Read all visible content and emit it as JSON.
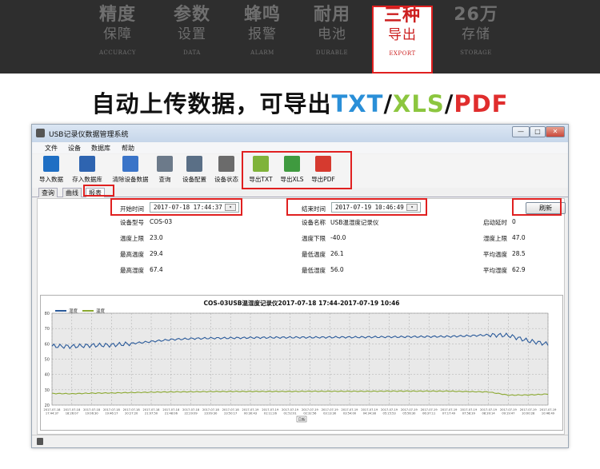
{
  "features": [
    {
      "big": "精度",
      "mid": "保障",
      "sml": "ACCURACY"
    },
    {
      "big": "参数",
      "mid": "设置",
      "sml": "DATA"
    },
    {
      "big": "蜂鸣",
      "mid": "报警",
      "sml": "ALARM"
    },
    {
      "big": "耐用",
      "mid": "电池",
      "sml": "DURABLE"
    },
    {
      "big": "三种",
      "mid": "导出",
      "sml": "EXPORT"
    },
    {
      "big": "26万",
      "mid": "存储",
      "sml": "STORAGE"
    }
  ],
  "headline": {
    "prefix": "自动上传数据，可导出",
    "txt": "TXT",
    "sep1": "/",
    "xls": "XLS",
    "sep2": "/",
    "pdf": "PDF",
    "colors": {
      "txt": "#2a8fd8",
      "xls": "#8cc63f",
      "pdf": "#e02d2d"
    }
  },
  "window": {
    "title": "USB记录仪数据管理系统",
    "controls": {
      "min": "—",
      "max": "□",
      "close": "✕"
    }
  },
  "menu": [
    "文件",
    "设备",
    "数据库",
    "帮助"
  ],
  "toolbar": [
    {
      "label": "导入数据",
      "icon": "import-data-icon"
    },
    {
      "label": "存入数据库",
      "icon": "save-database-icon"
    },
    {
      "label": "清除设备数据",
      "icon": "clear-device-icon"
    },
    {
      "label": "查询",
      "icon": "search-icon"
    },
    {
      "label": "设备配置",
      "icon": "device-config-icon"
    },
    {
      "label": "设备状态",
      "icon": "device-status-icon"
    },
    {
      "label": "导出TXT",
      "icon": "export-txt-icon"
    },
    {
      "label": "导出XLS",
      "icon": "export-xls-icon"
    },
    {
      "label": "导出PDF",
      "icon": "export-pdf-icon"
    }
  ],
  "tabs": [
    "查询",
    "曲线",
    "报表"
  ],
  "report": {
    "start_label": "开始时间",
    "start_value": "2017-07-18 17:44:37",
    "end_label": "结束时间",
    "end_value": "2017-07-19 10:46:49",
    "refresh": "刷新",
    "fields": [
      {
        "label": "设备型号",
        "value": "COS-03"
      },
      {
        "label": "设备名称",
        "value": "USB温湿度记录仪"
      },
      {
        "label": "启动延时",
        "value": "0"
      },
      {
        "label": "温度上限",
        "value": "23.0"
      },
      {
        "label": "温度下限",
        "value": "-40.0"
      },
      {
        "label": "湿度上限",
        "value": "47.0"
      },
      {
        "label": "最高温度",
        "value": "29.4"
      },
      {
        "label": "最低温度",
        "value": "26.1"
      },
      {
        "label": "平均温度",
        "value": "28.5"
      },
      {
        "label": "最高湿度",
        "value": "67.4"
      },
      {
        "label": "最低湿度",
        "value": "56.0"
      },
      {
        "label": "平均湿度",
        "value": "62.9"
      }
    ]
  },
  "chart_data": {
    "type": "line",
    "title": "COS-03USB温湿度记录仪2017-07-18 17:44-2017-07-19 10:46",
    "xlabel": "日期",
    "ylabel": "",
    "ylim": [
      20,
      80
    ],
    "yticks": [
      20,
      30,
      40,
      50,
      60,
      70,
      80
    ],
    "grid": true,
    "legend_placement": "top-left",
    "x": [
      "2017-07-18 17:44:37",
      "2017-07-18 18:26:07",
      "2017-07-18 19:06:30",
      "2017-07-18 19:46:17",
      "2017-07-18 20:27:20",
      "2017-07-18 21:07:50",
      "2017-07-18 21:48:06",
      "2017-07-18 22:29:09",
      "2017-07-18 23:09:30",
      "2017-07-18 23:50:17",
      "2017-07-19 00:30:43",
      "2017-07-19 01:11:26",
      "2017-07-19 01:52:01",
      "2017-07-19 02:32:56",
      "2017-07-19 03:13:30",
      "2017-07-19 03:54:00",
      "2017-07-19 04:34:38",
      "2017-07-19 05:15:53",
      "2017-07-19 05:56:30",
      "2017-07-19 06:37:11",
      "2017-07-19 07:17:49",
      "2017-07-19 07:58:39",
      "2017-07-19 08:39:14",
      "2017-07-19 09:19:47",
      "2017-07-19 10:00:28",
      "2017-07-19 10:46:49"
    ],
    "series": [
      {
        "name": "湿度",
        "color": "#2a5a9a",
        "values": [
          58.5,
          58.3,
          59.0,
          59.2,
          60.2,
          61.5,
          62.8,
          63.4,
          63.7,
          63.8,
          64.0,
          64.1,
          64.2,
          64.2,
          64.3,
          64.3,
          64.4,
          64.5,
          64.6,
          64.7,
          64.8,
          65.2,
          65.8,
          65.5,
          62.0,
          59.8
        ]
      },
      {
        "name": "温度",
        "color": "#8aa830",
        "values": [
          27.6,
          27.4,
          27.8,
          27.9,
          28.2,
          28.4,
          28.6,
          28.7,
          28.8,
          28.9,
          28.9,
          28.9,
          28.9,
          29.0,
          29.0,
          29.0,
          29.0,
          29.1,
          29.1,
          29.1,
          29.1,
          28.8,
          28.6,
          26.5,
          26.6,
          27.2
        ]
      }
    ]
  }
}
